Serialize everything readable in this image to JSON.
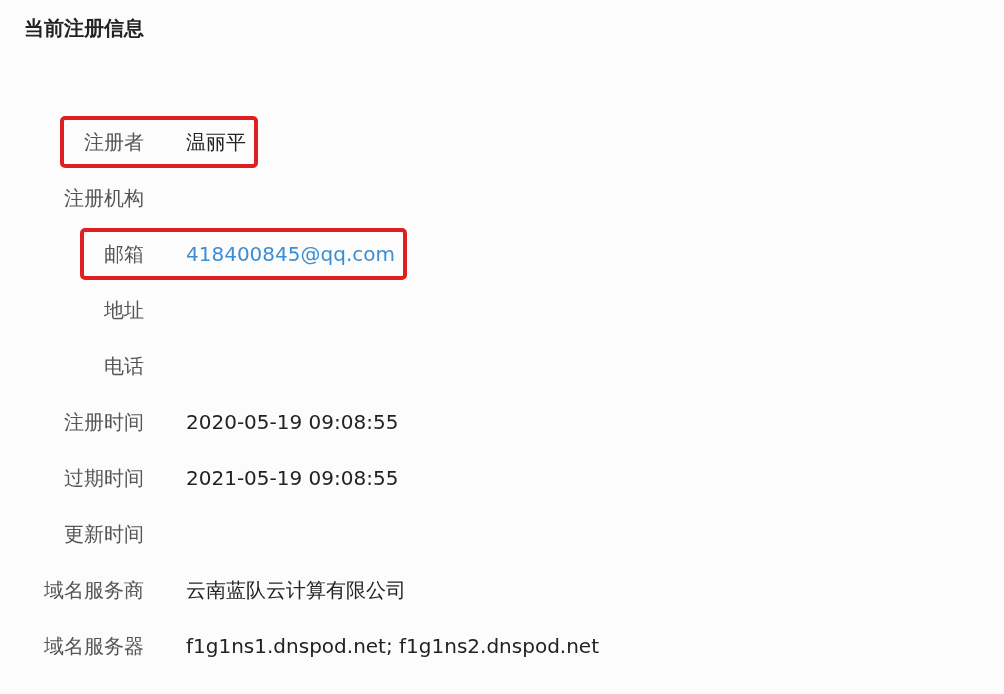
{
  "title": "当前注册信息",
  "rows": [
    {
      "label": "注册者",
      "value": "温丽平",
      "kind": "text",
      "highlighted": true
    },
    {
      "label": "注册机构",
      "highlighted": false
    },
    {
      "label": "邮箱",
      "value": "418400845@qq.com",
      "kind": "link",
      "highlighted": true
    },
    {
      "label": "地址",
      "highlighted": false
    },
    {
      "label": "电话",
      "highlighted": false
    },
    {
      "label": "注册时间",
      "value": "2020-05-19 09:08:55",
      "kind": "text",
      "highlighted": false
    },
    {
      "label": "过期时间",
      "value": "2021-05-19 09:08:55",
      "kind": "text",
      "highlighted": false
    },
    {
      "label": "更新时间",
      "highlighted": false
    },
    {
      "label": "域名服务商",
      "value": "云南蓝队云计算有限公司",
      "kind": "text",
      "highlighted": false
    },
    {
      "label": "域名服务器",
      "value": "f1g1ns1.dnspod.net; f1g1ns2.dnspod.net",
      "kind": "text",
      "highlighted": false
    }
  ]
}
